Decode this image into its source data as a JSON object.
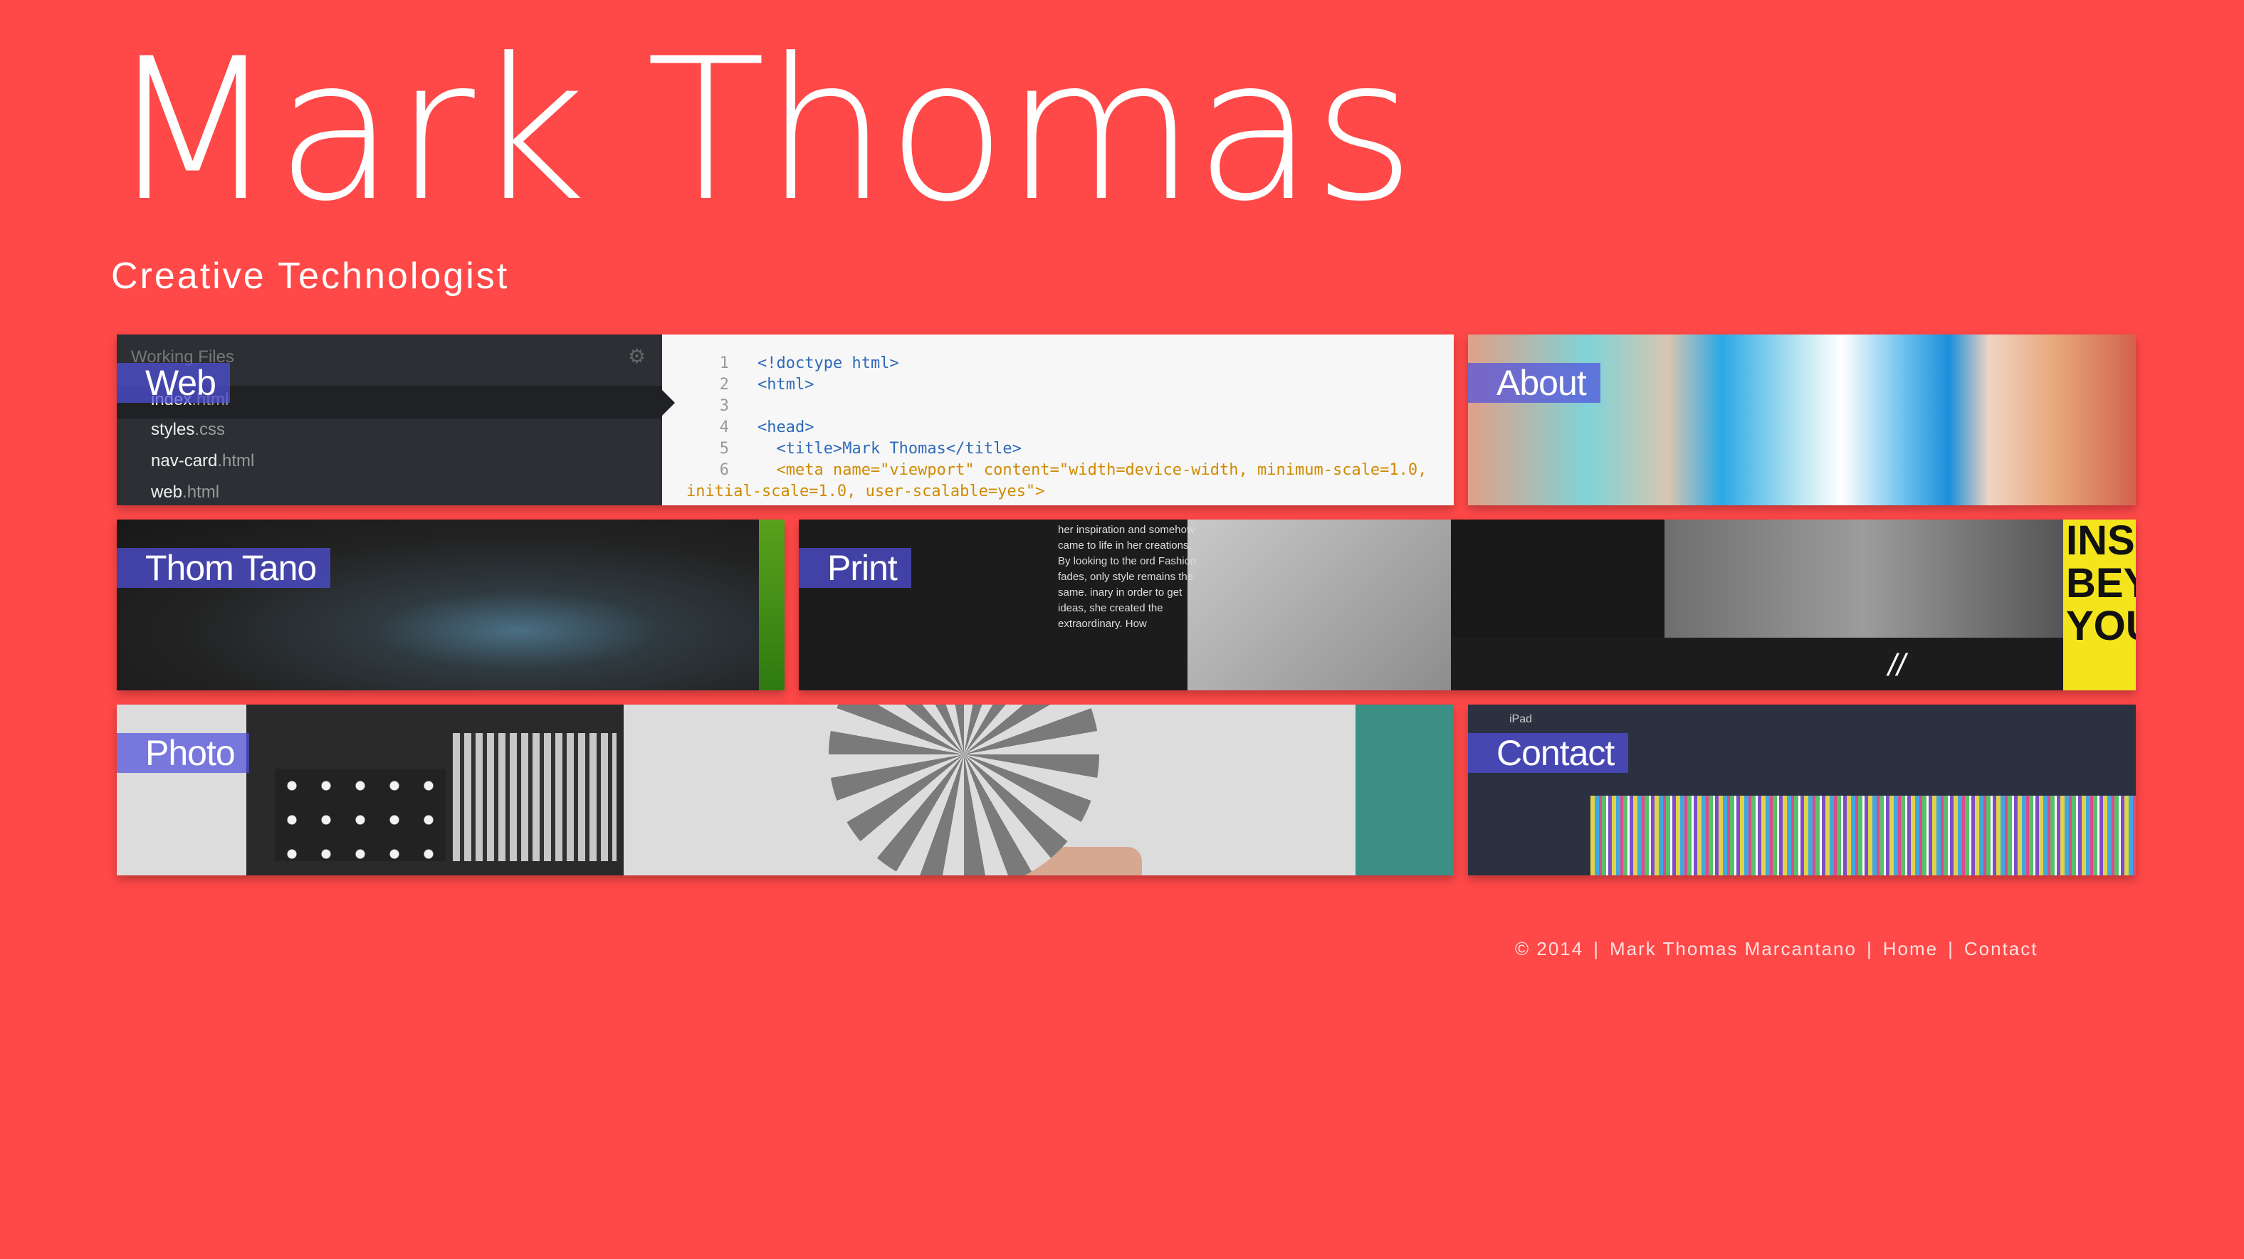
{
  "header": {
    "title": "Mark Thomas",
    "subtitle": "Creative Technologist"
  },
  "tiles": {
    "web": {
      "label": "Web",
      "editor": {
        "panel_title": "Working Files",
        "files": [
          {
            "name": "index",
            "ext": ".html"
          },
          {
            "name": "styles",
            "ext": ".css"
          },
          {
            "name": "nav-card",
            "ext": ".html"
          },
          {
            "name": "web",
            "ext": ".html"
          }
        ],
        "code_lines": [
          {
            "num": "1",
            "text": "<!doctype html>"
          },
          {
            "num": "2",
            "text": "<html>"
          },
          {
            "num": "3",
            "text": ""
          },
          {
            "num": "4",
            "text": "<head>"
          },
          {
            "num": "5",
            "text": "  <title>Mark Thomas</title>"
          },
          {
            "num": "6",
            "text": "  <meta name=\"viewport\" content=\"width=device-width, minimum-scale=1.0,"
          },
          {
            "num": "",
            "text": "initial-scale=1.0, user-scalable=yes\">"
          }
        ]
      }
    },
    "about": {
      "label": "About"
    },
    "thom_tano": {
      "label": "Thom Tano"
    },
    "print": {
      "label": "Print",
      "text": "her inspiration and somehow came to life in her creations. By looking to the ord Fashion fades, only style remains the same. inary in order to get ideas, she created the extraordinary. How",
      "slashes": "//",
      "poster_text": [
        "INS",
        "BEY",
        "YOU"
      ]
    },
    "photo": {
      "label": "Photo"
    },
    "contact": {
      "label": "Contact",
      "device_text": "iPad"
    }
  },
  "footer": {
    "copyright": "© 2014",
    "name": "Mark Thomas Marcantano",
    "home": "Home",
    "contact": "Contact",
    "separator": "|"
  },
  "colors": {
    "background": "#ff4848",
    "label_bg": "#5050dc"
  }
}
